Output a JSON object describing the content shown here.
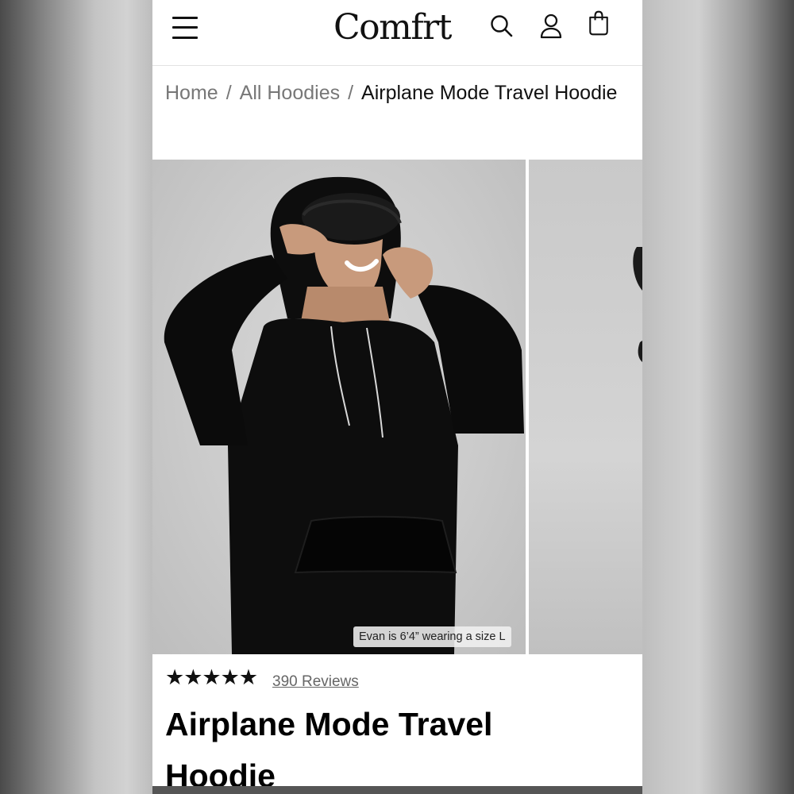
{
  "header": {
    "logo": "Comfrt",
    "menu_icon": "hamburger-menu-icon",
    "search_icon": "search-icon",
    "account_icon": "user-icon",
    "cart_icon": "shopping-bag-icon"
  },
  "breadcrumb": {
    "items": [
      "Home",
      "All Hoodies"
    ],
    "current": "Airplane Mode Travel Hoodie",
    "separator": "/"
  },
  "gallery": {
    "caption": "Evan is 6’4” wearing a size L"
  },
  "product": {
    "stars": "★★★★★",
    "rating": 5,
    "reviews_label": "390 Reviews",
    "title": "Airplane Mode Travel Hoodie"
  },
  "colors": {
    "text": "#111111",
    "link_gray": "#777777",
    "hoodie": "#0d0d0d",
    "backdrop": "#cfcfcf"
  }
}
